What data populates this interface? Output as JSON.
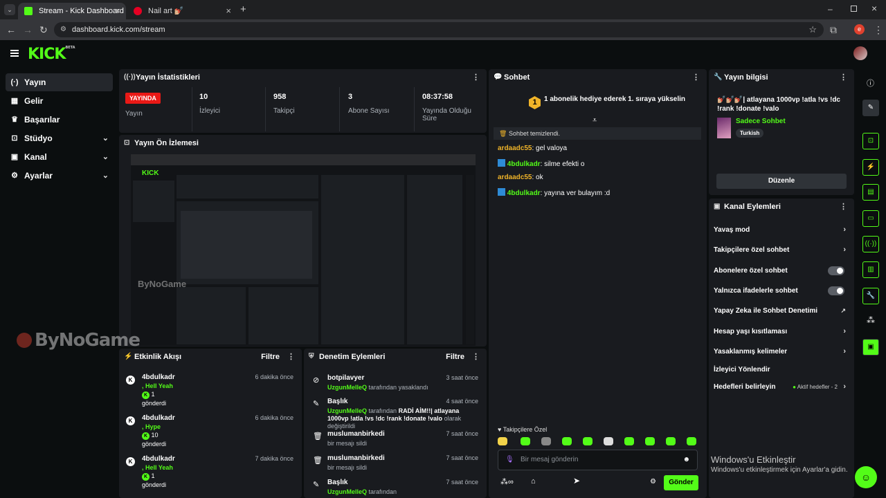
{
  "browser": {
    "tabs": [
      {
        "title": "Stream - Kick Dashboard",
        "active": true
      },
      {
        "title": "Nail art 💅🏼",
        "active": false
      }
    ],
    "url": "dashboard.kick.com/stream",
    "profile_initial": "e"
  },
  "brand": {
    "logo": "KICK",
    "beta": "BETA",
    "accent": "#53fc18"
  },
  "sidebar": {
    "items": [
      {
        "label": "Yayın",
        "icon": "broadcast-icon"
      },
      {
        "label": "Gelir",
        "icon": "dashboard-icon"
      },
      {
        "label": "Başarılar",
        "icon": "trophy-icon"
      },
      {
        "label": "Stüdyo",
        "icon": "studio-icon"
      },
      {
        "label": "Kanal",
        "icon": "channel-icon"
      },
      {
        "label": "Ayarlar",
        "icon": "gear-icon"
      }
    ]
  },
  "stats": {
    "title": "Yayın İstatistikleri",
    "live_badge": "YAYINDA",
    "live_label": "Yayın",
    "viewers_value": "10",
    "viewers_label": "İzleyici",
    "followers_value": "958",
    "followers_label": "Takipçi",
    "subs_value": "3",
    "subs_label": "Abone Sayısı",
    "uptime_value": "08:37:58",
    "uptime_label": "Yayında Olduğu Süre"
  },
  "preview": {
    "title": "Yayın Ön İzlemesi",
    "watermark": "ByNoGame"
  },
  "activity": {
    "title": "Etkinlik Akışı",
    "filter": "Filtre",
    "items": [
      {
        "name": "4bdulkadr",
        "time": "6 dakika önce",
        "msg": ", Hell Yeah",
        "amount": "1",
        "sent": "gönderdi"
      },
      {
        "name": "4bdulkadr",
        "time": "6 dakika önce",
        "msg": ", Hype",
        "amount": "10",
        "sent": "gönderdi"
      },
      {
        "name": "4bdulkadr",
        "time": "7 dakika önce",
        "msg": ", Hell Yeah",
        "amount": "1",
        "sent": "gönderdi"
      }
    ]
  },
  "moderation": {
    "title": "Denetim Eylemleri",
    "filter": "Filtre",
    "items": [
      {
        "name": "botpilavyer",
        "time": "3 saat önce",
        "actor": "UzgunMelleQ",
        "desc": "tarafından yasaklandı"
      },
      {
        "name": "Başlık",
        "time": "4 saat önce",
        "actor": "UzgunMelleQ",
        "desc": "tarafından",
        "detail": "RADİ AİM!!| atlayana 1000vp !atla !vs !dc !rank !donate !valo",
        "tail": "olarak değiştirildi"
      },
      {
        "name": "muslumanbirkedi",
        "time": "7 saat önce",
        "desc": "bir mesajı sildi"
      },
      {
        "name": "muslumanbirkedi",
        "time": "7 saat önce",
        "desc": "bir mesajı sildi"
      },
      {
        "name": "Başlık",
        "time": "7 saat önce",
        "actor": "UzgunMelleQ",
        "desc": "tarafından"
      }
    ]
  },
  "chat": {
    "title": "Sohbet",
    "pinned": "1 abonelik hediye ederek 1. sıraya yükselin",
    "pinned_rank": "1",
    "cleared": "Sohbet temizlendi.",
    "messages": [
      {
        "user": "ardaadc55",
        "text": "gel valoya",
        "badge": false
      },
      {
        "user": "4bdulkadr",
        "text": "silme efekti o",
        "badge": true
      },
      {
        "user": "ardaadc55",
        "text": "ok",
        "badge": false
      },
      {
        "user": "4bdulkadr",
        "text": "yayına ver bulayım :d",
        "badge": true
      }
    ],
    "followers_only": "Takipçilere Özel",
    "input_placeholder": "Bir mesaj gönderin",
    "send": "Gönder"
  },
  "stream_info": {
    "title": "Yayın bilgisi",
    "stream_title": "💅🏼💅🏼💅🏼| atlayana 1000vp !atla !vs !dc !rank !donate !valo",
    "category": "Sadece Sohbet",
    "language": "Turkish",
    "edit": "Düzenle"
  },
  "channel_actions": {
    "title": "Kanal Eylemleri",
    "rows": [
      {
        "label": "Yavaş mod",
        "control": "chevron"
      },
      {
        "label": "Takipçilere özel sohbet",
        "control": "chevron"
      },
      {
        "label": "Abonelere özel sohbet",
        "control": "toggle"
      },
      {
        "label": "Yalnızca ifadelerle sohbet",
        "control": "toggle"
      },
      {
        "label": "Yapay Zeka ile Sohbet Denetimi",
        "control": "external"
      },
      {
        "label": "Hesap yaşı kısıtlaması",
        "control": "chevron"
      },
      {
        "label": "Yasaklanmış kelimeler",
        "control": "chevron"
      },
      {
        "label": "İzleyici Yönlendir",
        "control": "none"
      },
      {
        "label": "Hedefleri belirleyin",
        "control": "chevron",
        "status": "Aktif hedefler - 2"
      }
    ]
  },
  "watermark": {
    "brand": "ByNoGame"
  },
  "windows": {
    "line1": "Windows'u Etkinleştir",
    "line2": "Windows'u etkinleştirmek için Ayarlar'a gidin."
  }
}
